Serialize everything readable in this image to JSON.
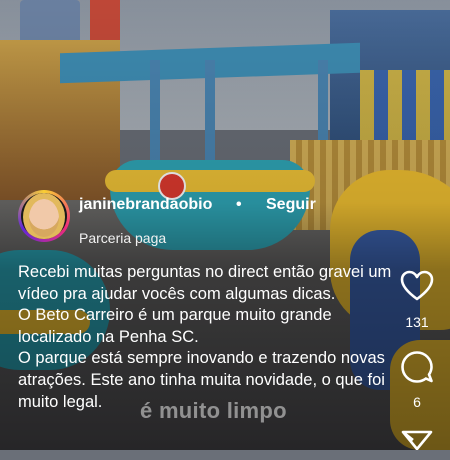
{
  "post": {
    "username": "janinebrandaobio",
    "separator": "•",
    "follow_label": "Seguir",
    "partnership_label": "Parceria paga",
    "caption_lines": [
      "Recebi muitas perguntas no direct então gravei um vídeo pra ajudar vocês com algumas dicas.",
      "O Beto Carreiro é um parque muito grande localizado na Penha SC.",
      "O parque está sempre inovando e trazendo novas atrações. Este ano tinha muita novidade, o que foi muito legal."
    ],
    "video_overlay_text": "é muito limpo"
  },
  "actions": {
    "like_icon": "heart-icon",
    "like_count": "131",
    "comment_icon": "speech-bubble-icon",
    "comment_count": "6",
    "share_icon": "paper-plane-icon"
  },
  "colors": {
    "text": "#ffffff",
    "avatar_ring_start": "#f9ce34",
    "avatar_ring_mid": "#ee2a7b",
    "avatar_ring_end": "#6228d7"
  }
}
